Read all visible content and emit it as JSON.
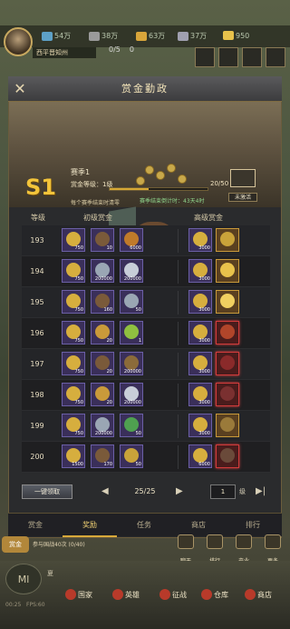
{
  "hud": {
    "city_name": "西平晋知州",
    "resources": [
      {
        "name": "wood",
        "value": "54万",
        "color": "#5ea1c7"
      },
      {
        "name": "iron",
        "value": "38万",
        "color": "#9a9a9a"
      },
      {
        "name": "food",
        "value": "63万",
        "color": "#d8a53a"
      },
      {
        "name": "stone",
        "value": "37万",
        "color": "#a0a0b0"
      },
      {
        "name": "gold",
        "value": "950",
        "color": "#e8c24b"
      }
    ],
    "troops": "0/5",
    "troops_x": "0"
  },
  "panel": {
    "title": "赏金勤政",
    "season_code": "S1",
    "season_name": "赛季1",
    "bounty_level_label": "赏金等级：1级",
    "progress_text": "20/50",
    "progress": 0.4,
    "season_note": "每个赛季结束时清零",
    "countdown": "赛季结束倒计时：43天4时",
    "chest_label": "未激活",
    "col_level": "等级",
    "col_basic": "初级赏金",
    "col_advanced": "高级赏金",
    "rows": [
      {
        "level": "193",
        "basic": [
          {
            "q": "750",
            "t": "gold"
          },
          {
            "q": "10",
            "t": "chest"
          },
          {
            "q": "6000",
            "t": "scroll"
          }
        ],
        "adv": [
          {
            "q": "3000",
            "t": "gold"
          },
          {
            "q": "",
            "t": "mystery",
            "red": false
          }
        ]
      },
      {
        "level": "194",
        "basic": [
          {
            "q": "750",
            "t": "gold"
          },
          {
            "q": "200000",
            "t": "silver"
          },
          {
            "q": "200000",
            "t": "ingot"
          }
        ],
        "adv": [
          {
            "q": "3000",
            "t": "gold"
          },
          {
            "q": "",
            "t": "goldscroll",
            "red": false
          }
        ]
      },
      {
        "level": "195",
        "basic": [
          {
            "q": "750",
            "t": "gold"
          },
          {
            "q": "160",
            "t": "chest"
          },
          {
            "q": "50",
            "t": "silver"
          }
        ],
        "adv": [
          {
            "q": "3000",
            "t": "gold"
          },
          {
            "q": "",
            "t": "goldwings",
            "red": false
          }
        ]
      },
      {
        "level": "196",
        "basic": [
          {
            "q": "750",
            "t": "gold"
          },
          {
            "q": "20",
            "t": "feather"
          },
          {
            "q": "1",
            "t": "sickle"
          }
        ],
        "adv": [
          {
            "q": "3000",
            "t": "gold"
          },
          {
            "q": "",
            "t": "redchest",
            "red": true
          }
        ]
      },
      {
        "level": "197",
        "basic": [
          {
            "q": "750",
            "t": "gold"
          },
          {
            "q": "20",
            "t": "chest"
          },
          {
            "q": "200000",
            "t": "bag"
          }
        ],
        "adv": [
          {
            "q": "3000",
            "t": "gold"
          },
          {
            "q": "",
            "t": "redbook",
            "red": true
          }
        ]
      },
      {
        "level": "198",
        "basic": [
          {
            "q": "750",
            "t": "gold"
          },
          {
            "q": "20",
            "t": "feather"
          },
          {
            "q": "200000",
            "t": "ingot"
          }
        ],
        "adv": [
          {
            "q": "3000",
            "t": "gold"
          },
          {
            "q": "",
            "t": "redsword",
            "red": true
          }
        ]
      },
      {
        "level": "199",
        "basic": [
          {
            "q": "750",
            "t": "gold"
          },
          {
            "q": "200000",
            "t": "silver"
          },
          {
            "q": "50",
            "t": "potion"
          }
        ],
        "adv": [
          {
            "q": "3000",
            "t": "gold"
          },
          {
            "q": "",
            "t": "chestgold",
            "red": false
          }
        ]
      },
      {
        "level": "200",
        "basic": [
          {
            "q": "1500",
            "t": "gold"
          },
          {
            "q": "170",
            "t": "chest"
          },
          {
            "q": "50",
            "t": "mystery"
          }
        ],
        "adv": [
          {
            "q": "6000",
            "t": "gold"
          },
          {
            "q": "",
            "t": "hero",
            "red": true
          }
        ]
      }
    ],
    "claim_all": "一键领取",
    "page": "25/25",
    "level_input": "1",
    "level_unit": "级",
    "tabs": [
      "赏金",
      "奖励",
      "任务",
      "商店",
      "排行"
    ],
    "active_tab": 1
  },
  "chat": {
    "badge": "赏金",
    "text": "参与国战40次 (0/40)"
  },
  "right_buttons": [
    "聊天",
    "排行",
    "产业",
    "更多"
  ],
  "bottom": {
    "castle_label": "Ml",
    "weather": "夏",
    "time": "00:25",
    "fps": "FPS:60",
    "nav": [
      "国家",
      "英雄",
      "征战",
      "仓库",
      "商店"
    ]
  }
}
